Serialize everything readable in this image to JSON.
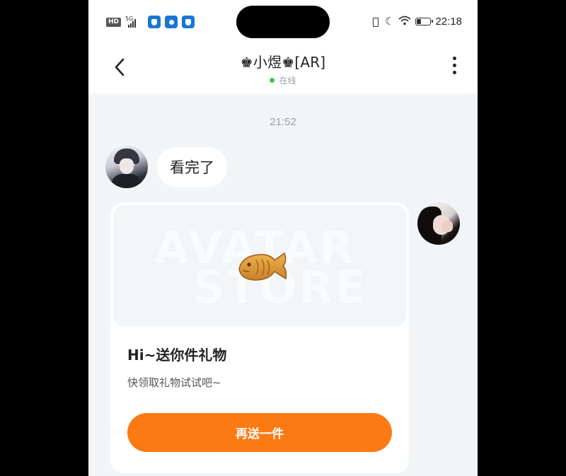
{
  "status_bar": {
    "hd": "HD",
    "network": "5G",
    "time": "22:18",
    "battery_level": 0.3
  },
  "header": {
    "title": "♚小煜♚[AR]",
    "status": "在线"
  },
  "chat": {
    "timestamp": "21:52",
    "messages": [
      {
        "sender": "other",
        "text": "看完了"
      }
    ],
    "gift_card": {
      "watermark_line1": "AVATAR",
      "watermark_line2": "STORE",
      "title": "Hi~送你件礼物",
      "subtitle": "快领取礼物试试吧~",
      "button_label": "再送一件",
      "button_color": "#fb7a14"
    }
  },
  "colors": {
    "online": "#35c759",
    "background": "#f1f5f8"
  }
}
